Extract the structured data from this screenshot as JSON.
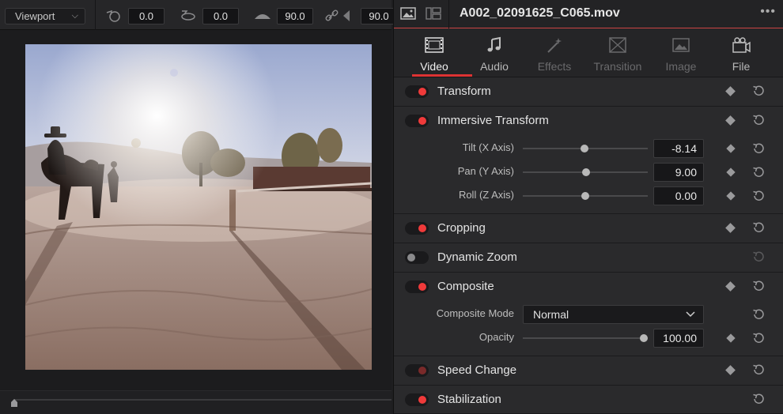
{
  "viewer": {
    "mode_select": "Viewport",
    "values": [
      "0.0",
      "0.0",
      "90.0",
      "90.0"
    ]
  },
  "inspector": {
    "filename": "A002_02091625_C065.mov",
    "more": "•••",
    "tabs": [
      {
        "label": "Video",
        "icon": "film-icon",
        "state": "active"
      },
      {
        "label": "Audio",
        "icon": "music-note-icon",
        "state": "normal"
      },
      {
        "label": "Effects",
        "icon": "magic-wand-icon",
        "state": "dim"
      },
      {
        "label": "Transition",
        "icon": "transition-icon",
        "state": "dim"
      },
      {
        "label": "Image",
        "icon": "image-icon",
        "state": "dim"
      },
      {
        "label": "File",
        "icon": "file-reel-icon",
        "state": "normal"
      }
    ],
    "sections": {
      "transform": "Transform",
      "immersive": "Immersive Transform",
      "tilt_label": "Tilt (X Axis)",
      "tilt_value": "-8.14",
      "pan_label": "Pan (Y Axis)",
      "pan_value": "9.00",
      "roll_label": "Roll (Z Axis)",
      "roll_value": "0.00",
      "cropping": "Cropping",
      "dynamic_zoom": "Dynamic Zoom",
      "composite": "Composite",
      "composite_mode_label": "Composite Mode",
      "composite_mode_value": "Normal",
      "opacity_label": "Opacity",
      "opacity_value": "100.00",
      "speed_change": "Speed Change",
      "stabilization": "Stabilization"
    },
    "slider_fractions": {
      "tilt": 0.49,
      "pan": 0.51,
      "roll": 0.5,
      "opacity": 1.0
    }
  },
  "colors": {
    "accent": "#f03a3a",
    "panel": "#2a2a2c",
    "active_underline": "#d33333"
  }
}
